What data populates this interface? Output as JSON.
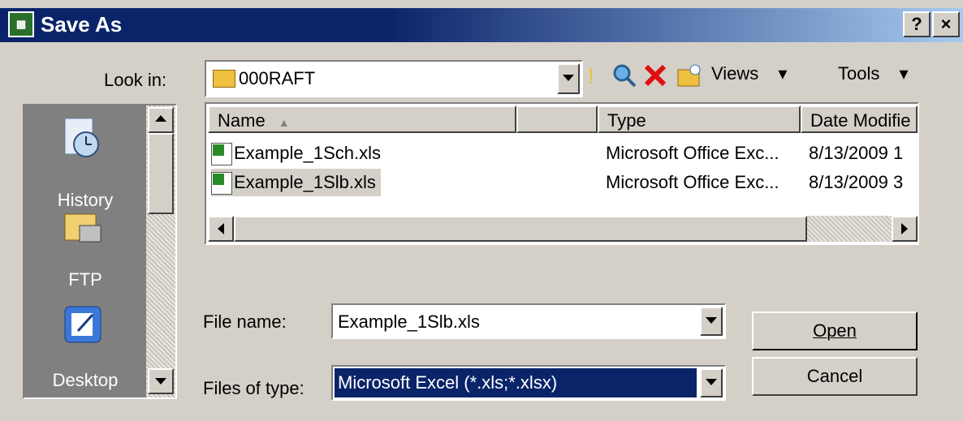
{
  "window": {
    "title": "Save As",
    "help_label": "?",
    "close_label": "×"
  },
  "lookin": {
    "label": "Look in:",
    "value": "000RAFT"
  },
  "toolbar": {
    "views_label": "Views",
    "tools_label": "Tools"
  },
  "places": [
    {
      "label": "History",
      "icon": "history-icon"
    },
    {
      "label": "FTP",
      "icon": "ftp-icon"
    },
    {
      "label": "Desktop",
      "icon": "desktop-icon"
    }
  ],
  "filelist": {
    "columns": [
      "Name",
      "",
      "Type",
      "Date Modifie"
    ],
    "rows": [
      {
        "name": "Example_1Sch.xls",
        "type": "Microsoft Office Exc...",
        "date": "8/13/2009 1"
      },
      {
        "name": "Example_1Slb.xls",
        "type": "Microsoft Office Exc...",
        "date": "8/13/2009 3"
      }
    ]
  },
  "filename": {
    "label": "File name:",
    "value": "Example_1Slb.xls"
  },
  "filetype": {
    "label": "Files of type:",
    "value": "Microsoft Excel (*.xls;*.xlsx)"
  },
  "buttons": {
    "open": "Open",
    "cancel": "Cancel"
  },
  "colors": {
    "title_bar": "#0a246a",
    "selection": "#0a246a",
    "face": "#d4d0c8"
  }
}
